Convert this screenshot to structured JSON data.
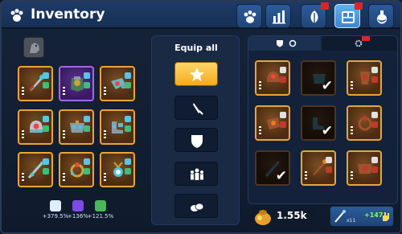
{
  "header": {
    "title": "Inventory",
    "tabs": [
      {
        "name": "pets",
        "icon": "paw-icon",
        "active": false,
        "notif": false
      },
      {
        "name": "stats",
        "icon": "bars-icon",
        "active": false,
        "notif": false
      },
      {
        "name": "skills",
        "icon": "leaf-icon",
        "active": false,
        "notif": true
      },
      {
        "name": "inventory",
        "icon": "chest-icon",
        "active": true,
        "notif": true
      },
      {
        "name": "potions",
        "icon": "potion-icon",
        "active": false,
        "notif": false
      }
    ]
  },
  "equipped": {
    "bonuses": [
      {
        "icon": "shield-icon",
        "value": "+379.5%",
        "color": "#9fd7ff"
      },
      {
        "icon": "pet-icon",
        "value": "+136%",
        "color": "#7c4ae6"
      },
      {
        "icon": "sprout-icon",
        "value": "+121.5%",
        "color": "#48b85a"
      }
    ]
  },
  "equip_panel": {
    "title": "Equip all",
    "buttons": [
      "star-icon",
      "sword-icon",
      "shield-icon",
      "crowd-icon",
      "eggs-icon"
    ]
  },
  "currency": {
    "coins": "1.55k",
    "orbs": "x11",
    "orb_rate": "+147"
  },
  "colors": {
    "accent": "#f2ab1f",
    "frame": "#15233a",
    "active_tab": "#4a9ae2"
  }
}
